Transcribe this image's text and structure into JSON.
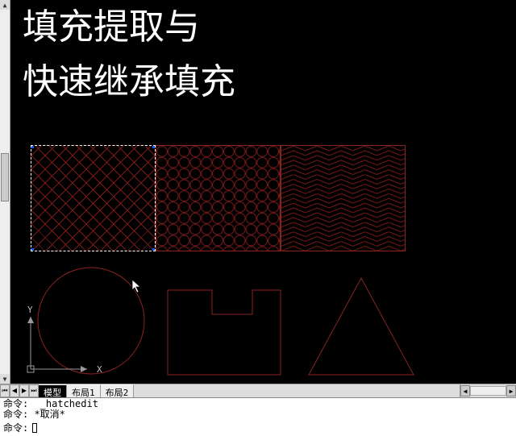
{
  "title": {
    "line1": "填充提取与",
    "line2": "快速继承填充"
  },
  "ucs": {
    "x": "X",
    "y": "Y"
  },
  "tabs": {
    "items": [
      {
        "label": "模型",
        "active": true
      },
      {
        "label": "布局1",
        "active": false
      },
      {
        "label": "布局2",
        "active": false
      }
    ],
    "nav": {
      "first": "⏮",
      "prev": "◀",
      "next": "▶",
      "last": "⏭"
    }
  },
  "command": {
    "hist1": "命令:  _hatchedit",
    "hist2": "命令: *取消*",
    "prompt_label": "命令: "
  },
  "patterns": {
    "selected_index": 0,
    "names": [
      "herringbone-wide",
      "honeycomb-circles",
      "herringbone-narrow"
    ]
  },
  "shapes": [
    "circle",
    "notched-rectangle",
    "triangle"
  ]
}
